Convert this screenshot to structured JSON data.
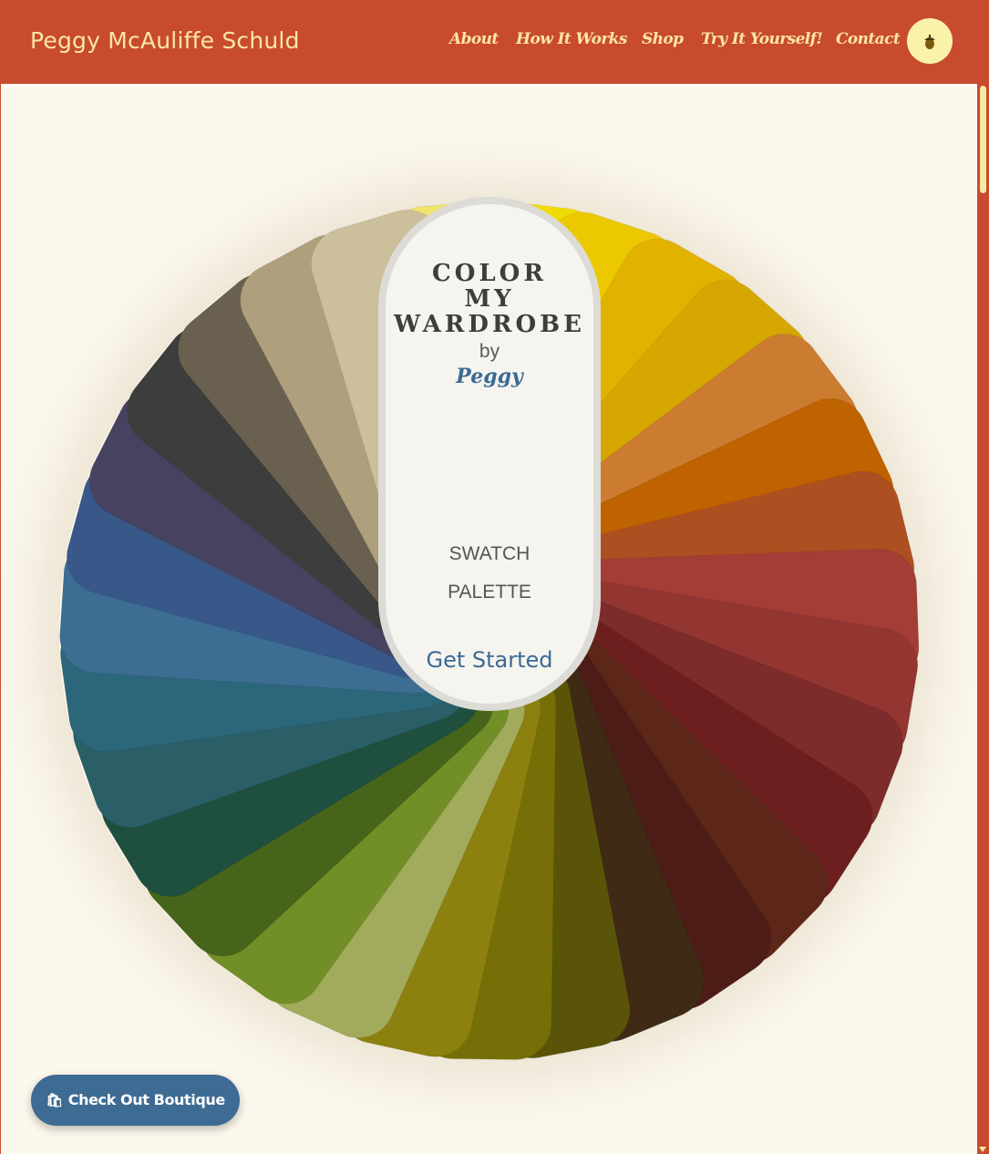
{
  "header": {
    "brand": "Peggy McAuliffe Schuld",
    "nav": [
      {
        "label": "About",
        "name": "nav-about"
      },
      {
        "label": "How It Works",
        "name": "nav-how-it-works"
      },
      {
        "label": "Shop",
        "name": "nav-shop"
      },
      {
        "label": "Try It Yourself!",
        "name": "nav-try-it-yourself"
      },
      {
        "label": "Contact",
        "name": "nav-contact"
      }
    ],
    "icon_button": "acorn-icon"
  },
  "hero": {
    "title_lines": [
      "COLOR",
      "MY",
      "WARDROBE"
    ],
    "by": "by",
    "author": "Peggy",
    "options": [
      "SWATCH",
      "PALETTE"
    ],
    "cta": "Get Started"
  },
  "wheel": {
    "swatch_colors": [
      "#f1e46b",
      "#efdc00",
      "#ecc800",
      "#e2b200",
      "#d5a700",
      "#cc7c30",
      "#bf6200",
      "#ad5021",
      "#a53d37",
      "#933631",
      "#7d2b2b",
      "#6d1f1f",
      "#5c2719",
      "#4d1c17",
      "#3e2a15",
      "#5a5409",
      "#766f07",
      "#8c800f",
      "#a2aa5c",
      "#728f27",
      "#47651a",
      "#1f4f3f",
      "#2b5f67",
      "#2c667a",
      "#3c6d92",
      "#385889",
      "#474260",
      "#3d3d3d",
      "#6a604f",
      "#ae9f7d",
      "#cbbf9c"
    ]
  },
  "boutique_button": {
    "label": "Check Out Boutique",
    "icon": "shopping-bag-icon"
  },
  "colors": {
    "header_bg": "#c84b2f",
    "header_text": "#fbe6a2",
    "page_bg": "#fcf8ee",
    "accent_blue": "#3b6a96"
  }
}
